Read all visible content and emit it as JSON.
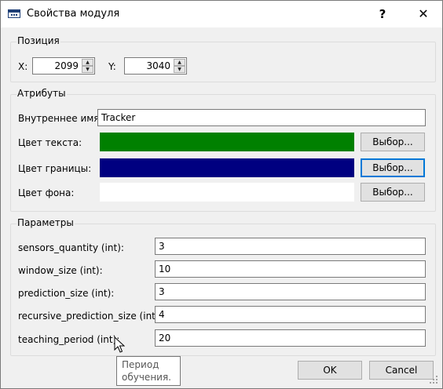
{
  "window": {
    "title": "Свойства модуля",
    "help_label": "?",
    "close_label": "✕"
  },
  "position": {
    "group_title": "Позиция",
    "x_label": "X:",
    "x_value": "2099",
    "y_label": "Y:",
    "y_value": "3040"
  },
  "attributes": {
    "group_title": "Атрибуты",
    "internal_name_label": "Внутреннее имя:",
    "internal_name_value": "Tracker",
    "text_color_label": "Цвет текста:",
    "text_color": "#008000",
    "border_color_label": "Цвет границы:",
    "border_color": "#000080",
    "bg_color_label": "Цвет фона:",
    "bg_color": "#ffffff",
    "choose_label": "Выбор..."
  },
  "parameters": {
    "group_title": "Параметры",
    "items": [
      {
        "label": "sensors_quantity (int):",
        "value": "3"
      },
      {
        "label": "window_size (int):",
        "value": "10"
      },
      {
        "label": "prediction_size (int):",
        "value": "3"
      },
      {
        "label": "recursive_prediction_size (int):",
        "value": "4"
      },
      {
        "label": "teaching_period (int):",
        "value": "20"
      }
    ]
  },
  "tooltip": {
    "line1": "Период",
    "line2": "обучения."
  },
  "footer": {
    "ok_label": "OK",
    "cancel_label": "Cancel"
  },
  "icons": {
    "app": "window-app-icon",
    "cursor": "mouse-pointer-icon",
    "spin_up": "▲",
    "spin_down": "▼"
  }
}
